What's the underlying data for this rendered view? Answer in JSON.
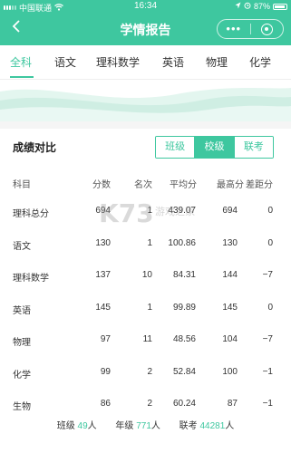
{
  "status_bar": {
    "carrier": "中国联通",
    "time": "16:34",
    "battery": "87%"
  },
  "nav": {
    "title": "学情报告",
    "more": "•••"
  },
  "tabs": [
    {
      "label": "全科",
      "active": true
    },
    {
      "label": "语文",
      "active": false
    },
    {
      "label": "理科数学",
      "active": false
    },
    {
      "label": "英语",
      "active": false
    },
    {
      "label": "物理",
      "active": false
    },
    {
      "label": "化学",
      "active": false
    }
  ],
  "card": {
    "title": "成绩对比",
    "segments": [
      {
        "label": "班级",
        "active": false
      },
      {
        "label": "校级",
        "active": true
      },
      {
        "label": "联考",
        "active": false
      }
    ]
  },
  "table": {
    "headers": {
      "subject": "科目",
      "score": "分数",
      "rank": "名次",
      "avg": "平均分",
      "max": "最高分",
      "gap": "差距分"
    },
    "rows": [
      {
        "subject": "理科总分",
        "score": "694",
        "rank": "1",
        "avg": "439.07",
        "max": "694",
        "gap": "0"
      },
      {
        "subject": "语文",
        "score": "130",
        "rank": "1",
        "avg": "100.86",
        "max": "130",
        "gap": "0"
      },
      {
        "subject": "理科数学",
        "score": "137",
        "rank": "10",
        "avg": "84.31",
        "max": "144",
        "gap": "−7"
      },
      {
        "subject": "英语",
        "score": "145",
        "rank": "1",
        "avg": "99.89",
        "max": "145",
        "gap": "0"
      },
      {
        "subject": "物理",
        "score": "97",
        "rank": "11",
        "avg": "48.56",
        "max": "104",
        "gap": "−7"
      },
      {
        "subject": "化学",
        "score": "99",
        "rank": "2",
        "avg": "52.84",
        "max": "100",
        "gap": "−1"
      },
      {
        "subject": "生物",
        "score": "86",
        "rank": "2",
        "avg": "60.24",
        "max": "87",
        "gap": "−1"
      }
    ]
  },
  "footer": {
    "class_label": "班级",
    "class_count": "49",
    "class_unit": "人",
    "grade_label": "年级",
    "grade_count": "771",
    "grade_unit": "人",
    "joint_label": "联考",
    "joint_count": "44281",
    "joint_unit": "人"
  },
  "watermark": {
    "text": "K73 游戏之家"
  },
  "colors": {
    "accent": "#3ec79f"
  }
}
